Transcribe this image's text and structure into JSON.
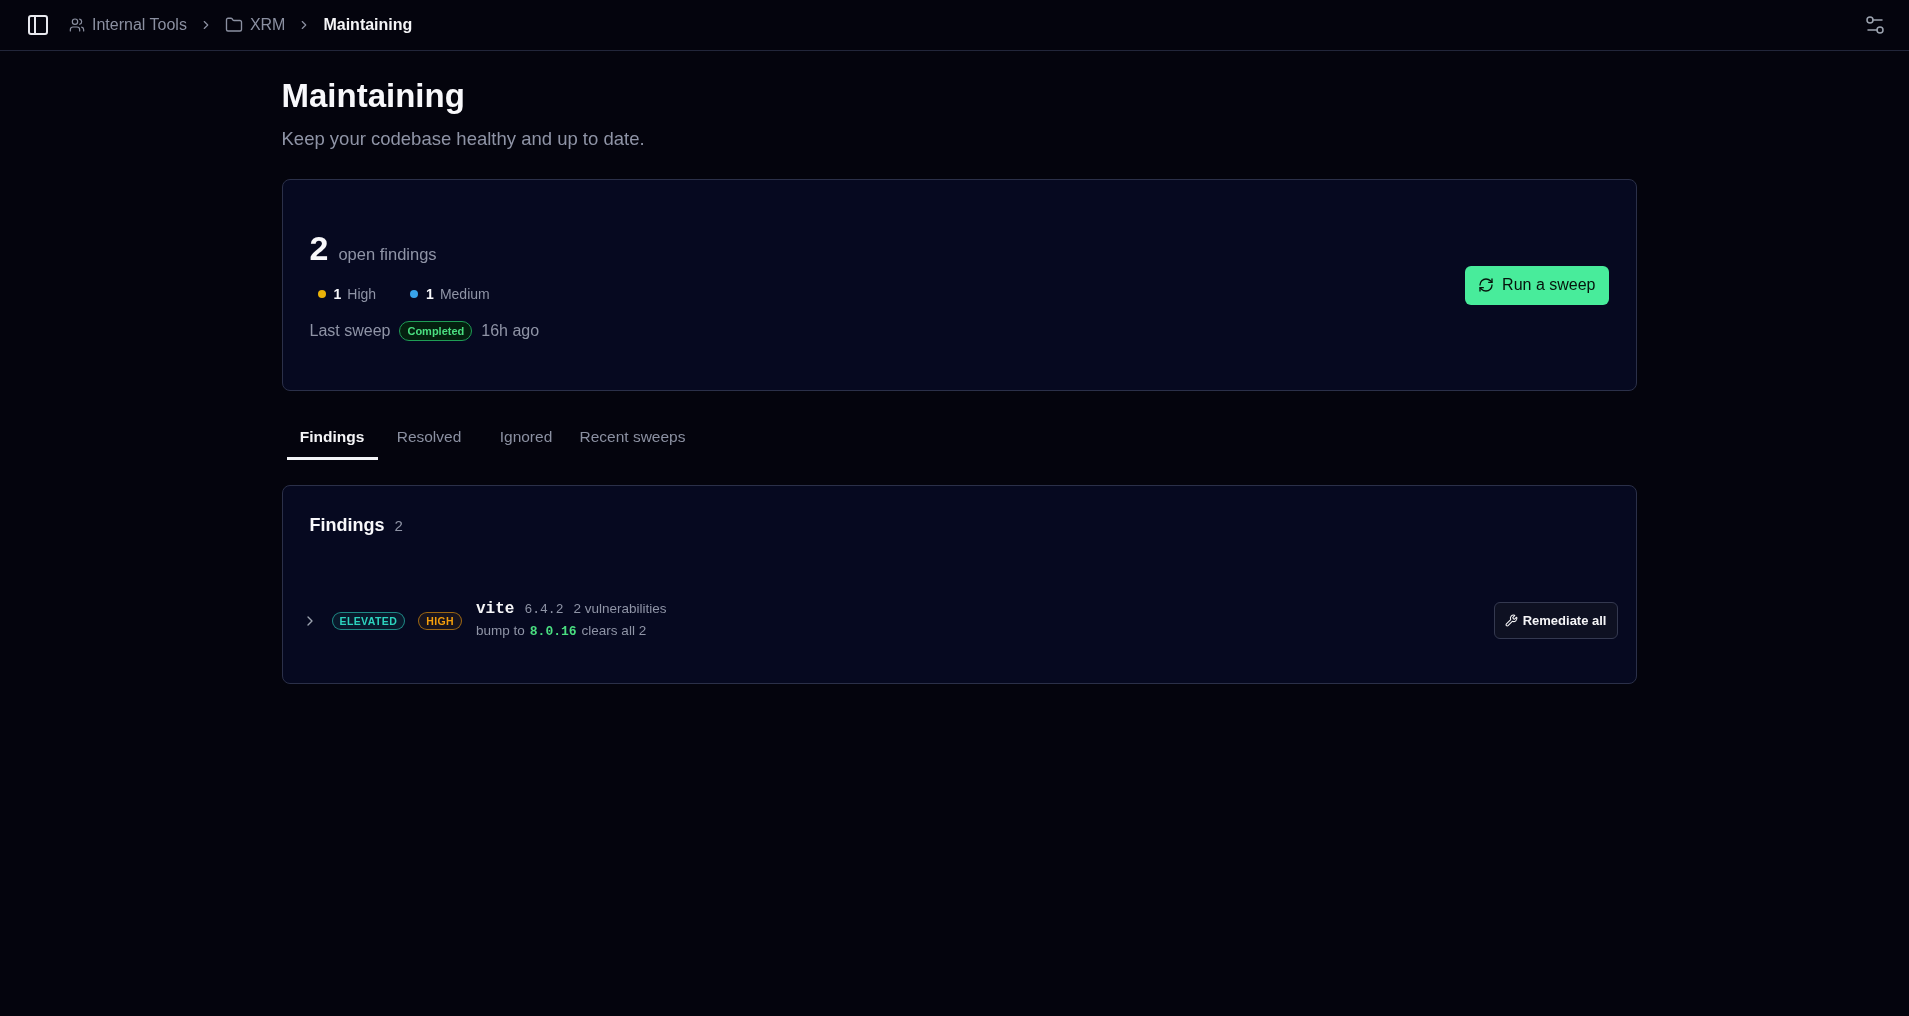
{
  "top_bar": {
    "breadcrumbs": [
      {
        "label": "Internal Tools",
        "kind": "team",
        "current": false
      },
      {
        "label": "XRM",
        "kind": "folder",
        "current": false
      },
      {
        "label": "Maintaining",
        "kind": "page",
        "current": true
      }
    ]
  },
  "page": {
    "title": "Maintaining",
    "subtitle": "Keep your codebase healthy and up to date."
  },
  "summary": {
    "count": "2",
    "count_label": "open findings",
    "severities": [
      {
        "count": "1",
        "label": "High",
        "color": "#eab308"
      },
      {
        "count": "1",
        "label": "Medium",
        "color": "#38a3ea"
      }
    ],
    "last_sweep": {
      "label": "Last sweep",
      "status": "Completed",
      "time": "16h ago"
    },
    "action": "Run a sweep"
  },
  "tabs": [
    {
      "label": "Findings",
      "selected": true
    },
    {
      "label": "Resolved",
      "selected": false
    },
    {
      "label": "Ignored",
      "selected": false
    },
    {
      "label": "Recent sweeps",
      "selected": false
    }
  ],
  "findings": {
    "title": "Findings",
    "count": "2",
    "rows": [
      {
        "expanded": false,
        "badges": [
          {
            "label": "ELEVATED",
            "color": "#2dd4bf"
          },
          {
            "label": "HIGH",
            "color": "#f59e0b"
          }
        ],
        "package": "vite",
        "version": "6.4.2",
        "vulnerabilities": "2 vulnerabilities",
        "fix_prefix": "bump to",
        "fix_version": "8.0.16",
        "fix_suffix": "clears all 2",
        "action": "Remediate all"
      }
    ]
  }
}
